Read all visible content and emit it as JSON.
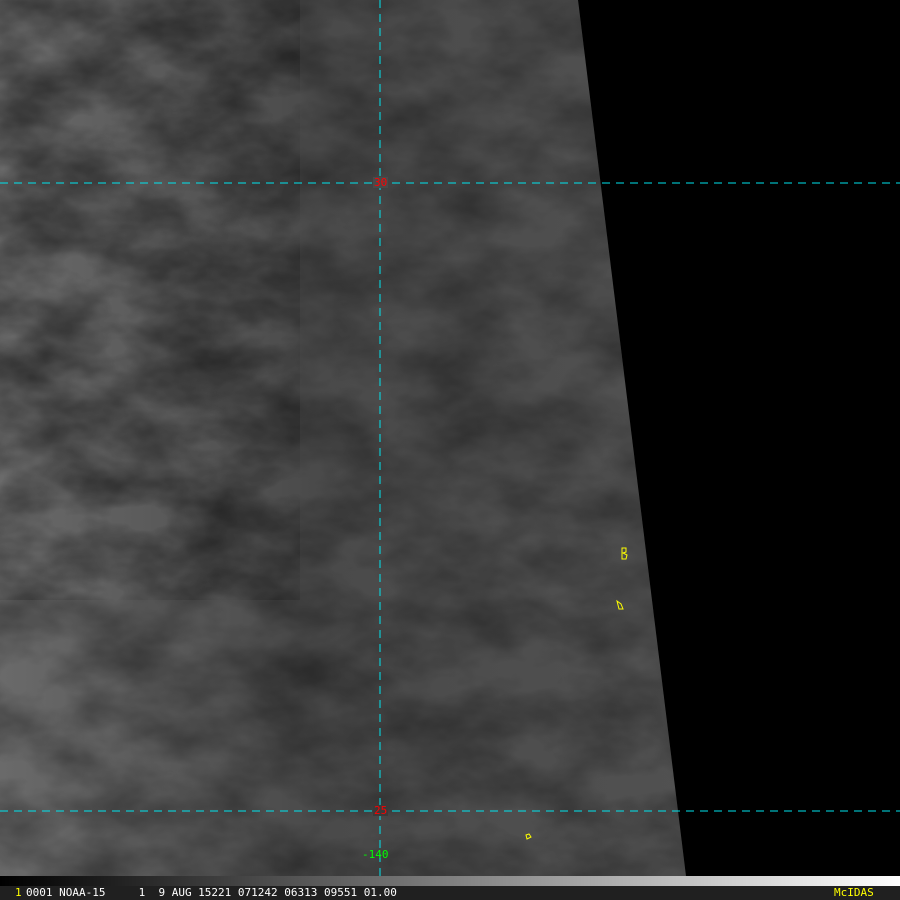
{
  "image": {
    "grid_labels": {
      "lat_30": "30",
      "lat_25": "25",
      "lon_140": "-140"
    },
    "colors": {
      "grid": "#00e5ee",
      "lat_label": "#ff0000",
      "lon_label": "#00ff00",
      "coast": "#ffff00"
    }
  },
  "status": {
    "frame": "1",
    "info": "0001 NOAA-15     1  9 AUG 15221 071242 06313 09551 01.00",
    "brand": "McIDAS"
  }
}
